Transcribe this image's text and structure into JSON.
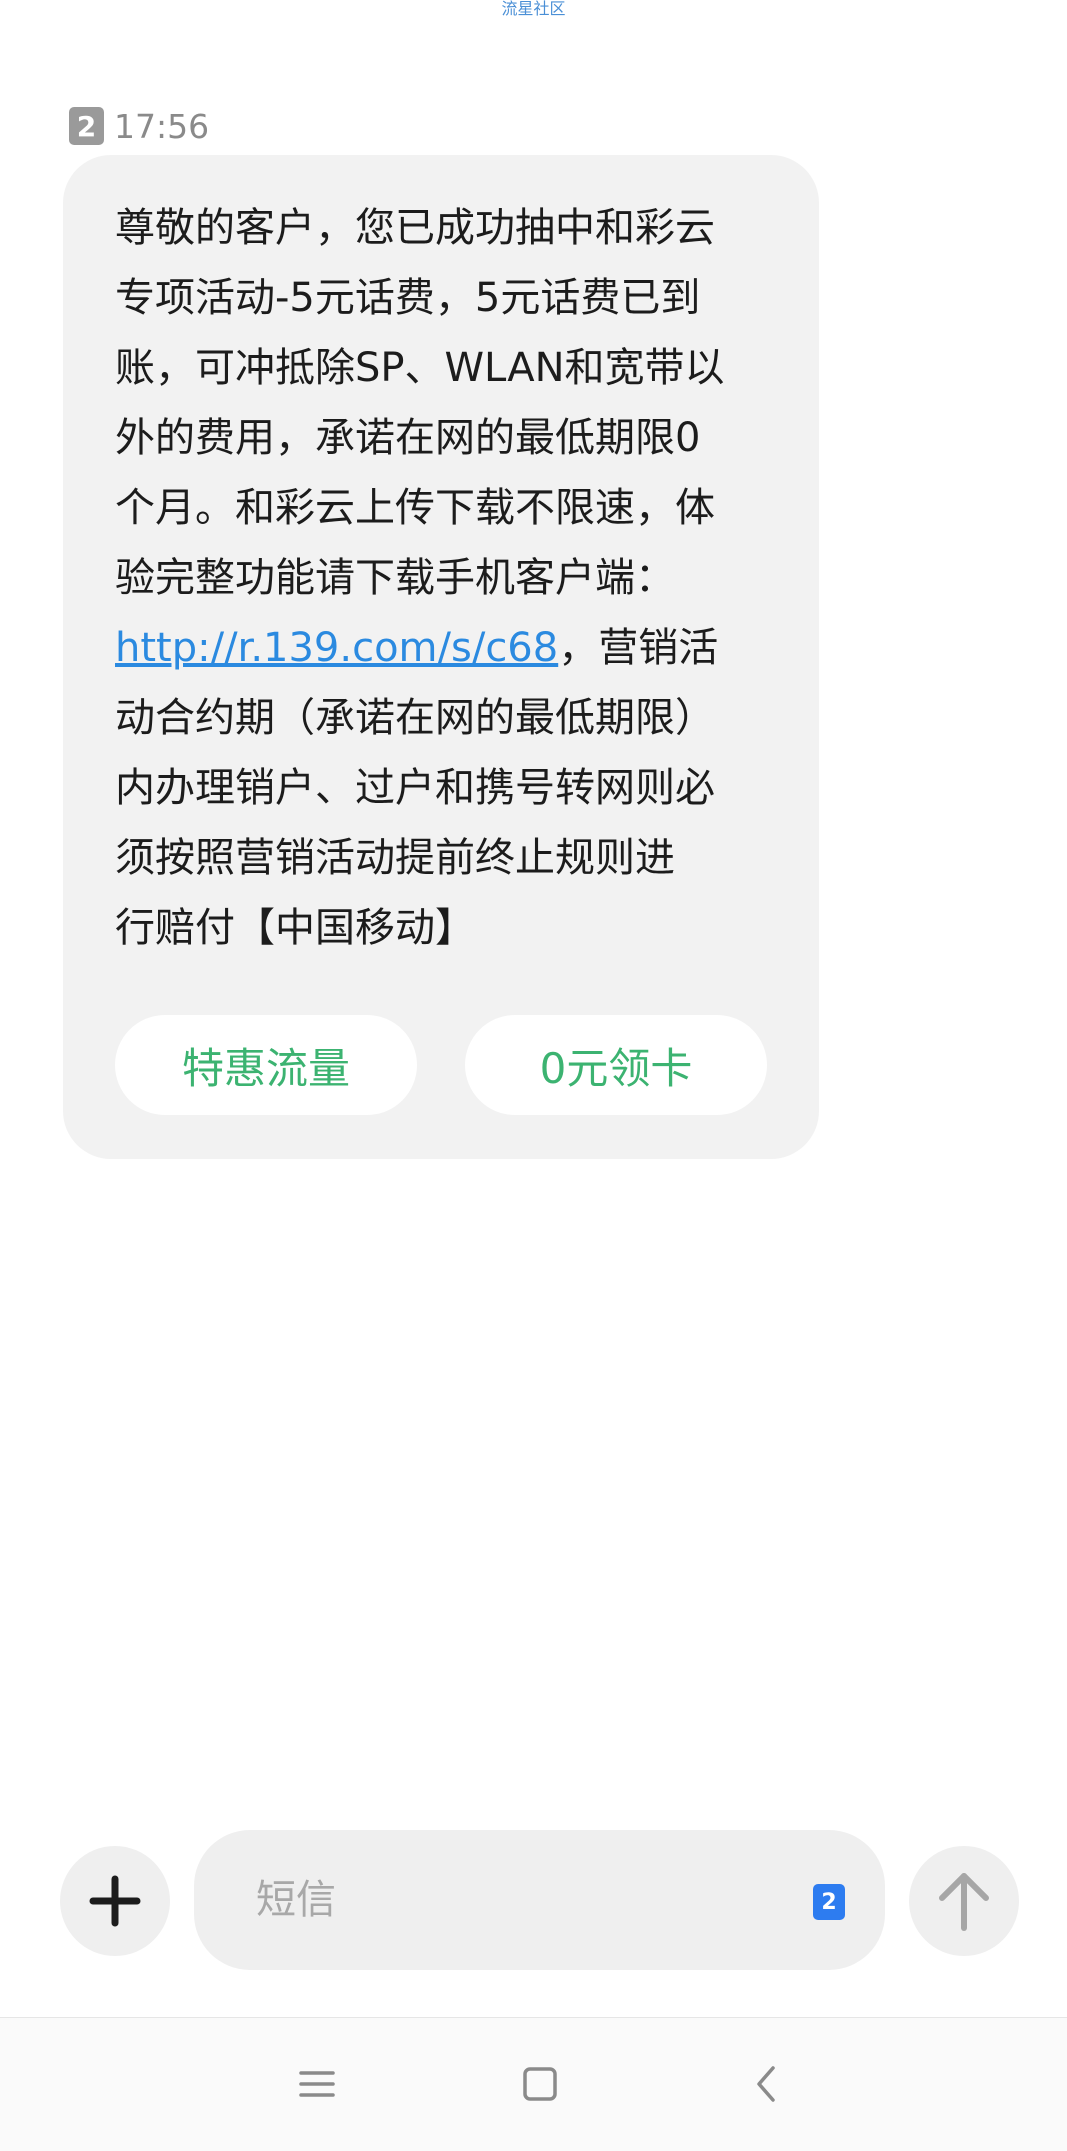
{
  "watermark": "流星社区",
  "message": {
    "sim_slot": "2",
    "time": "17:56",
    "text_before_link": "尊敬的客户，您已成功抽中和彩云\n专项活动-5元话费，5元话费已到\n账，可冲抵除SP、WLAN和宽带以\n外的费用，承诺在网的最低期限0\n个月。和彩云上传下载不限速，体\n验完整功能请下载手机客户端：\n",
    "link": "http://r.139.com/s/c68",
    "text_after_link": "，营销活\n动合约期（承诺在网的最低期限）\n内办理销户、过户和携号转网则必\n须按照营销活动提前终止规则进\n行赔付【中国移动】",
    "actions": [
      "特惠流量",
      "0元领卡"
    ]
  },
  "composer": {
    "placeholder": "短信",
    "sim_slot": "2"
  },
  "icons": {
    "attach": "plus-icon",
    "send": "arrow-up-icon",
    "nav_menu": "menu-icon",
    "nav_home": "square-icon",
    "nav_back": "chevron-left-icon"
  },
  "colors": {
    "link": "#2b8ae0",
    "action_text": "#3cb371",
    "sim_badge_selected": "#2d7cf0",
    "bubble_bg": "#f2f2f2"
  }
}
